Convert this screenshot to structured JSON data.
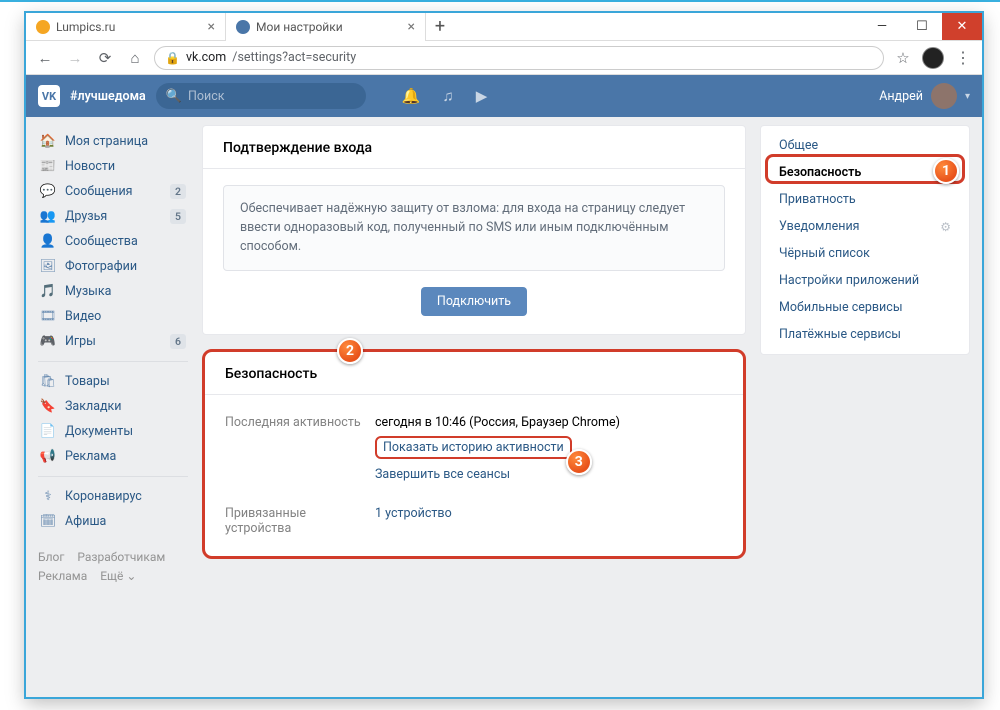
{
  "browser": {
    "tabs": [
      {
        "title": "Lumpics.ru",
        "favicon_color": "#f5a623"
      },
      {
        "title": "Мои настройки",
        "favicon_color": "#4a76a8"
      }
    ],
    "url_domain": "vk.com",
    "url_path": "/settings?act=security"
  },
  "vk_header": {
    "hashtag": "#лучшедома",
    "search_placeholder": "Поиск",
    "user_name": "Андрей"
  },
  "left_nav": {
    "items": [
      {
        "icon": "🏠",
        "label": "Моя страница",
        "badge": ""
      },
      {
        "icon": "📰",
        "label": "Новости",
        "badge": ""
      },
      {
        "icon": "💬",
        "label": "Сообщения",
        "badge": "2"
      },
      {
        "icon": "👥",
        "label": "Друзья",
        "badge": "5"
      },
      {
        "icon": "👤",
        "label": "Сообщества",
        "badge": ""
      },
      {
        "icon": "🖼",
        "label": "Фотографии",
        "badge": ""
      },
      {
        "icon": "🎵",
        "label": "Музыка",
        "badge": ""
      },
      {
        "icon": "🎞",
        "label": "Видео",
        "badge": ""
      },
      {
        "icon": "🎮",
        "label": "Игры",
        "badge": "6"
      }
    ],
    "items2": [
      {
        "icon": "🛍",
        "label": "Товары"
      },
      {
        "icon": "🔖",
        "label": "Закладки"
      },
      {
        "icon": "📄",
        "label": "Документы"
      },
      {
        "icon": "📢",
        "label": "Реклама"
      }
    ],
    "items3": [
      {
        "icon": "⚕",
        "label": "Коронавирус"
      },
      {
        "icon": "🗓",
        "label": "Афиша"
      }
    ],
    "footer": [
      "Блог",
      "Разработчикам",
      "Реклама",
      "Ещё ⌄"
    ]
  },
  "main": {
    "panel1_title": "Подтверждение входа",
    "panel1_text": "Обеспечивает надёжную защиту от взлома: для входа на страницу следует ввести одноразовый код, полученный по SMS или иным подключённым способом.",
    "panel1_button": "Подключить",
    "panel2_title": "Безопасность",
    "last_activity_label": "Последняя активность",
    "last_activity_value": "сегодня в 10:46 (Россия, Браузер Chrome)",
    "show_history_link": "Показать историю активности",
    "end_sessions_link": "Завершить все сеансы",
    "devices_label": "Привязанные устройства",
    "devices_value": "1 устройство"
  },
  "right_nav": {
    "items": [
      "Общее",
      "Безопасность",
      "Приватность",
      "Уведомления",
      "Чёрный список",
      "Настройки приложений",
      "Мобильные сервисы",
      "Платёжные сервисы"
    ],
    "active_index": 1,
    "gear_index": 3
  },
  "callouts": {
    "n1": "1",
    "n2": "2",
    "n3": "3"
  }
}
